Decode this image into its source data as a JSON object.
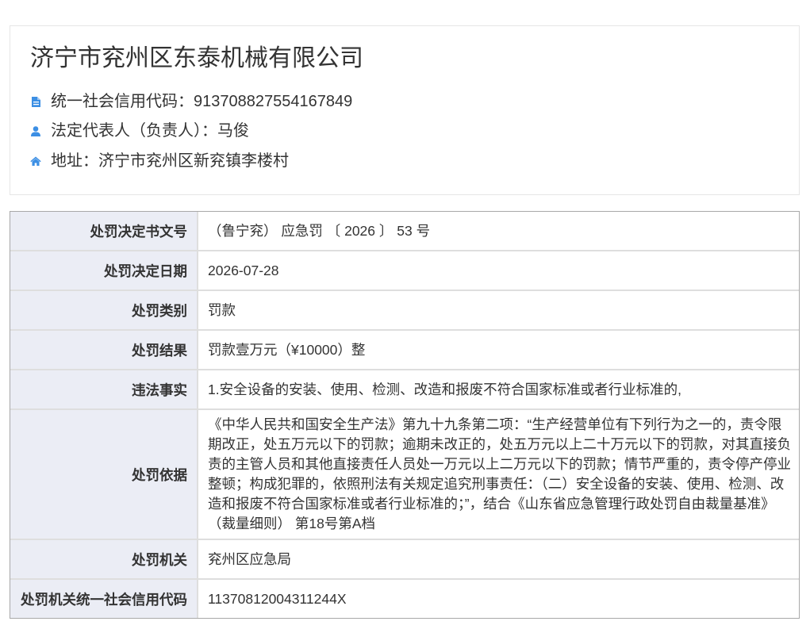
{
  "company": {
    "name": "济宁市兖州区东泰机械有限公司",
    "credit_code": {
      "icon": "document-icon",
      "label": "统一社会信用代码：",
      "value": "913708827554167849"
    },
    "legal_rep": {
      "icon": "user-icon",
      "label": "法定代表人（负责人）：",
      "value": "马俊"
    },
    "address": {
      "icon": "home-icon",
      "label": "地址：",
      "value": "济宁市兖州区新兖镇李楼村"
    }
  },
  "penalty": {
    "rows": [
      {
        "label": "处罚决定书文号",
        "value": "（鲁宁兖） 应急罚 〔 2026 〕 53 号"
      },
      {
        "label": "处罚决定日期",
        "value": "2026-07-28"
      },
      {
        "label": "处罚类别",
        "value": "罚款"
      },
      {
        "label": "处罚结果",
        "value": "罚款壹万元（¥10000）整"
      },
      {
        "label": "违法事实",
        "value": "1.安全设备的安装、使用、检测、改造和报废不符合国家标准或者行业标准的,"
      },
      {
        "label": "处罚依据",
        "value": "《中华人民共和国安全生产法》第九十九条第二项：“生产经营单位有下列行为之一的，责令限期改正，处五万元以下的罚款；逾期未改正的，处五万元以上二十万元以下的罚款，对其直接负责的主管人员和其他直接责任人员处一万元以上二万元以下的罚款；情节严重的，责令停产停业整顿；构成犯罪的，依照刑法有关规定追究刑事责任：（二）安全设备的安装、使用、检测、改造和报废不符合国家标准或者行业标准的；”，结合《山东省应急管理行政处罚自由裁量基准》（裁量细则） 第18号第A档"
      },
      {
        "label": "处罚机关",
        "value": "兖州区应急局"
      },
      {
        "label": "处罚机关统一社会信用代码",
        "value": "11370812004311244X"
      }
    ]
  },
  "colors": {
    "accent": "#3c8fe4",
    "label_background": "#ebedf5",
    "text": "#333333"
  }
}
